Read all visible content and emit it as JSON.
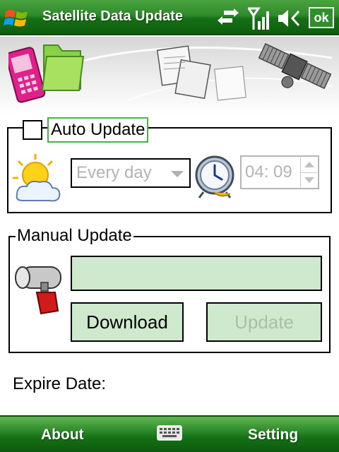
{
  "titlebar": {
    "title": "Satellite Data Update",
    "ok_label": "ok",
    "icons": [
      "windows-start-icon",
      "connectivity-arrows-icon",
      "signal-strength-icon",
      "volume-muted-icon"
    ]
  },
  "banner": {
    "icons": [
      "pink-phone-icon",
      "green-folder-icon",
      "document-pages-icon",
      "satellite-icon"
    ]
  },
  "auto_update": {
    "checkbox_label": "Auto Update",
    "checked": false,
    "frequency_value": "Every day",
    "time_value": "04: 09",
    "icons": [
      "sun-cloud-icon",
      "alarm-clock-icon"
    ]
  },
  "manual_update": {
    "caption": "Manual Update",
    "download_label": "Download",
    "update_label": "Update",
    "progress": 0,
    "icons": [
      "pipe-valve-icon"
    ]
  },
  "expire": {
    "label": "Expire Date:"
  },
  "softbar": {
    "left_label": "About",
    "right_label": "Setting",
    "center_icon": "keyboard-icon"
  },
  "colors": {
    "titlebar_green": "#2f8a2a",
    "button_fill": "#cfe9cf",
    "disabled_text": "#b3b3b3",
    "focus_border": "#4caf50"
  }
}
